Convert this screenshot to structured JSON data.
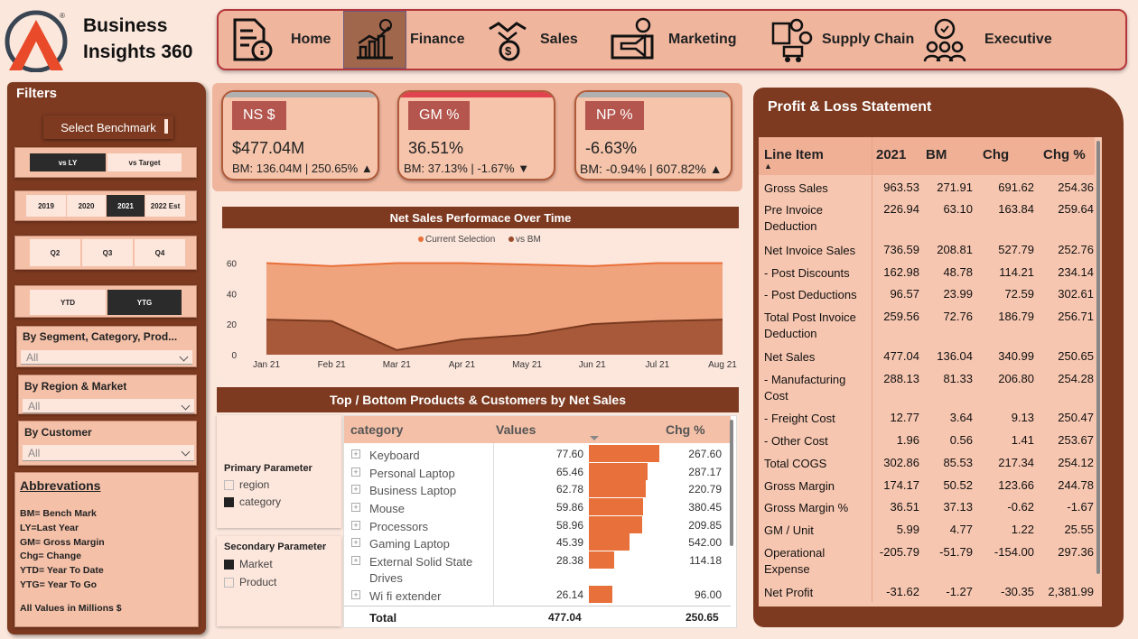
{
  "brand": {
    "line1": "Business",
    "line2": "Insights 360",
    "registered": "®"
  },
  "nav": {
    "items": [
      {
        "label": "",
        "icon": "document-info-icon"
      },
      {
        "label": "Home",
        "icon": "bar-growth-icon",
        "active": true
      },
      {
        "label": "Finance",
        "icon": "handshake-money-icon"
      },
      {
        "label": "Sales",
        "icon": "marketing-icon"
      },
      {
        "label": "Marketing",
        "icon": "supply-chain-icon"
      },
      {
        "label": "Supply Chain",
        "icon": "team-award-icon"
      },
      {
        "label": "Executive",
        "icon": ""
      }
    ]
  },
  "filters": {
    "title": "Filters",
    "benchmark_button": "Select Benchmark",
    "benchmark_options": [
      "vs LY",
      "vs Target"
    ],
    "benchmark_selected": "vs LY",
    "years": [
      "2019",
      "2020",
      "2021",
      "2022 Est"
    ],
    "year_selected": "2021",
    "quarters": [
      "Q2",
      "Q3",
      "Q4"
    ],
    "period": [
      "YTD",
      "YTG"
    ],
    "period_selected": "YTG",
    "segment_label": "By Segment, Category, Prod...",
    "segment_value": "All",
    "region_label": "By Region & Market",
    "region_value": "All",
    "customer_label": "By Customer",
    "customer_value": "All",
    "abbrev_title": "Abbrevations",
    "abbreviations": [
      "BM= Bench Mark",
      "LY=Last Year",
      "GM= Gross Margin",
      "Chg= Change",
      "YTD= Year To Date",
      "YTG= Year To Go"
    ],
    "units_note": "All Values in Millions $"
  },
  "kpis": [
    {
      "tag": "NS $",
      "value": "$477.04M",
      "bm": "BM: 136.04M | 250.65%",
      "arrow": "▲",
      "bar_color": "#b0b0b0"
    },
    {
      "tag": "GM %",
      "value": "36.51%",
      "bm": "BM: 37.13% | -1.67%",
      "arrow": "▼",
      "bar_color": "#e0434d"
    },
    {
      "tag": "NP %",
      "value": "-6.63%",
      "bm": "BM: -0.94% | 607.82%",
      "arrow": "▲",
      "bar_color": "#b0b0b0"
    }
  ],
  "chart_data": {
    "type": "area",
    "title": "Net Sales Performace Over Time",
    "categories": [
      "Jan 21",
      "Feb 21",
      "Mar 21",
      "Apr 21",
      "May 21",
      "Jun 21",
      "Jul 21",
      "Aug 21"
    ],
    "series": [
      {
        "name": "Current Selection",
        "values": [
          60,
          58,
          60,
          60,
          59,
          58,
          60,
          60
        ],
        "color": "#e8703a"
      },
      {
        "name": "vs BM",
        "values": [
          23,
          22,
          3,
          10,
          13,
          20,
          22,
          23
        ],
        "color": "#9a4a2a"
      }
    ],
    "yticks": [
      0,
      20,
      40,
      60
    ],
    "ylim": [
      0,
      65
    ],
    "legend_position": "top-center"
  },
  "topbottom": {
    "title": "Top / Bottom Products & Customers by Net Sales",
    "primary_label": "Primary Parameter",
    "primary_options": [
      {
        "label": "region",
        "checked": false
      },
      {
        "label": "category",
        "checked": true
      }
    ],
    "secondary_label": "Secondary Parameter",
    "secondary_options": [
      {
        "label": "Market",
        "checked": true
      },
      {
        "label": "Product",
        "checked": false
      }
    ],
    "columns": [
      "category",
      "Values",
      "Chg %"
    ],
    "rows": [
      {
        "name": "Keyboard",
        "value": "77.60",
        "chg": "267.60",
        "bar": 77.6
      },
      {
        "name": "Personal Laptop",
        "value": "65.46",
        "chg": "287.17",
        "bar": 65.46
      },
      {
        "name": "Business Laptop",
        "value": "62.78",
        "chg": "220.79",
        "bar": 62.78
      },
      {
        "name": "Mouse",
        "value": "59.86",
        "chg": "380.45",
        "bar": 59.86
      },
      {
        "name": "Processors",
        "value": "58.96",
        "chg": "209.85",
        "bar": 58.96
      },
      {
        "name": "Gaming Laptop",
        "value": "45.39",
        "chg": "542.00",
        "bar": 45.39
      },
      {
        "name": "External Solid State Drives",
        "value": "28.38",
        "chg": "114.18",
        "bar": 28.38
      },
      {
        "name": "Wi fi extender",
        "value": "26.14",
        "chg": "96.00",
        "bar": 26.14
      }
    ],
    "total_label": "Total",
    "total_value": "477.04",
    "total_chg": "250.65"
  },
  "pl": {
    "title": "Profit & Loss Statement",
    "columns": [
      "Line Item",
      "2021",
      "BM",
      "Chg",
      "Chg %"
    ],
    "rows": [
      {
        "item": "Gross Sales",
        "y": "963.53",
        "bm": "271.91",
        "chg": "691.62",
        "pct": "254.36"
      },
      {
        "item": "Pre Invoice Deduction",
        "y": "226.94",
        "bm": "63.10",
        "chg": "163.84",
        "pct": "259.64"
      },
      {
        "item": "Net Invoice Sales",
        "y": "736.59",
        "bm": "208.81",
        "chg": "527.79",
        "pct": "252.76"
      },
      {
        "item": "- Post Discounts",
        "y": "162.98",
        "bm": "48.78",
        "chg": "114.21",
        "pct": "234.14"
      },
      {
        "item": "- Post Deductions",
        "y": "96.57",
        "bm": "23.99",
        "chg": "72.59",
        "pct": "302.61"
      },
      {
        "item": "Total Post Invoice Deduction",
        "y": "259.56",
        "bm": "72.76",
        "chg": "186.79",
        "pct": "256.71"
      },
      {
        "item": "Net Sales",
        "y": "477.04",
        "bm": "136.04",
        "chg": "340.99",
        "pct": "250.65"
      },
      {
        "item": "- Manufacturing Cost",
        "y": "288.13",
        "bm": "81.33",
        "chg": "206.80",
        "pct": "254.28"
      },
      {
        "item": "- Freight Cost",
        "y": "12.77",
        "bm": "3.64",
        "chg": "9.13",
        "pct": "250.47"
      },
      {
        "item": "- Other Cost",
        "y": "1.96",
        "bm": "0.56",
        "chg": "1.41",
        "pct": "253.67"
      },
      {
        "item": "Total COGS",
        "y": "302.86",
        "bm": "85.53",
        "chg": "217.34",
        "pct": "254.12"
      },
      {
        "item": "Gross Margin",
        "y": "174.17",
        "bm": "50.52",
        "chg": "123.66",
        "pct": "244.78"
      },
      {
        "item": "Gross Margin %",
        "y": "36.51",
        "bm": "37.13",
        "chg": "-0.62",
        "pct": "-1.67"
      },
      {
        "item": "GM / Unit",
        "y": "5.99",
        "bm": "4.77",
        "chg": "1.22",
        "pct": "25.55"
      },
      {
        "item": "Operational Expense",
        "y": "-205.79",
        "bm": "-51.79",
        "chg": "-154.00",
        "pct": "297.36"
      },
      {
        "item": "Net Profit",
        "y": "-31.62",
        "bm": "-1.27",
        "chg": "-30.35",
        "pct": "2,381.99"
      }
    ]
  }
}
